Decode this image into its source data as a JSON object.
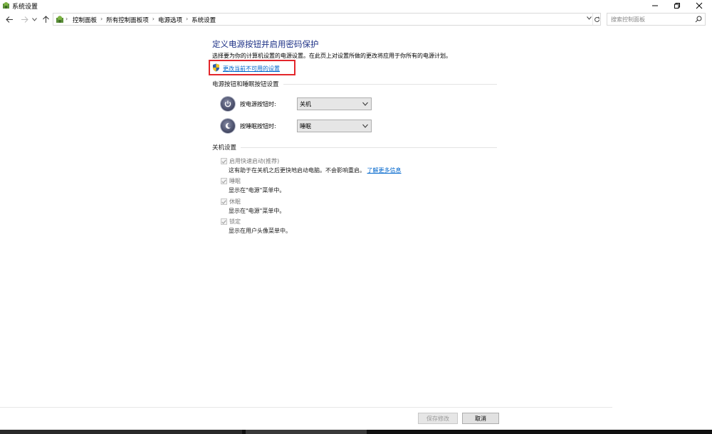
{
  "window": {
    "title": "系统设置",
    "buttons": {
      "minimize": "—",
      "maximize": "❐",
      "close": "✕"
    }
  },
  "nav": {
    "breadcrumbs": [
      "控制面板",
      "所有控制面板项",
      "电源选项",
      "系统设置"
    ],
    "search_placeholder": "搜索控制面板"
  },
  "main": {
    "heading": "定义电源按钮并启用密码保护",
    "description": "选择要为你的计算机设置的电源设置。在此页上对设置所做的更改将应用于你所有的电源计划。",
    "change_link": "更改当前不可用的设置",
    "power_section": {
      "label": "电源按钮和睡眠按钮设置",
      "power_button": {
        "label": "按电源按钮时:",
        "value": "关机"
      },
      "sleep_button": {
        "label": "按睡眠按钮时:",
        "value": "睡眠"
      }
    },
    "shutdown_section": {
      "label": "关机设置",
      "items": [
        {
          "label": "启用快速启动(推荐)",
          "desc": "这有助于在关机之后更快地启动电脑。不会影响重启。",
          "link": "了解更多信息",
          "checked": true
        },
        {
          "label": "睡眠",
          "desc": "显示在\"电源\"菜单中。",
          "checked": true
        },
        {
          "label": "休眠",
          "desc": "显示在\"电源\"菜单中。",
          "checked": true
        },
        {
          "label": "锁定",
          "desc": "显示在用户头像菜单中。",
          "checked": true
        }
      ]
    }
  },
  "footer": {
    "save_label": "保存修改",
    "cancel_label": "取消"
  },
  "colors": {
    "heading": "#1e3287",
    "link": "#0066cc",
    "highlight_box": "#e3262b"
  }
}
